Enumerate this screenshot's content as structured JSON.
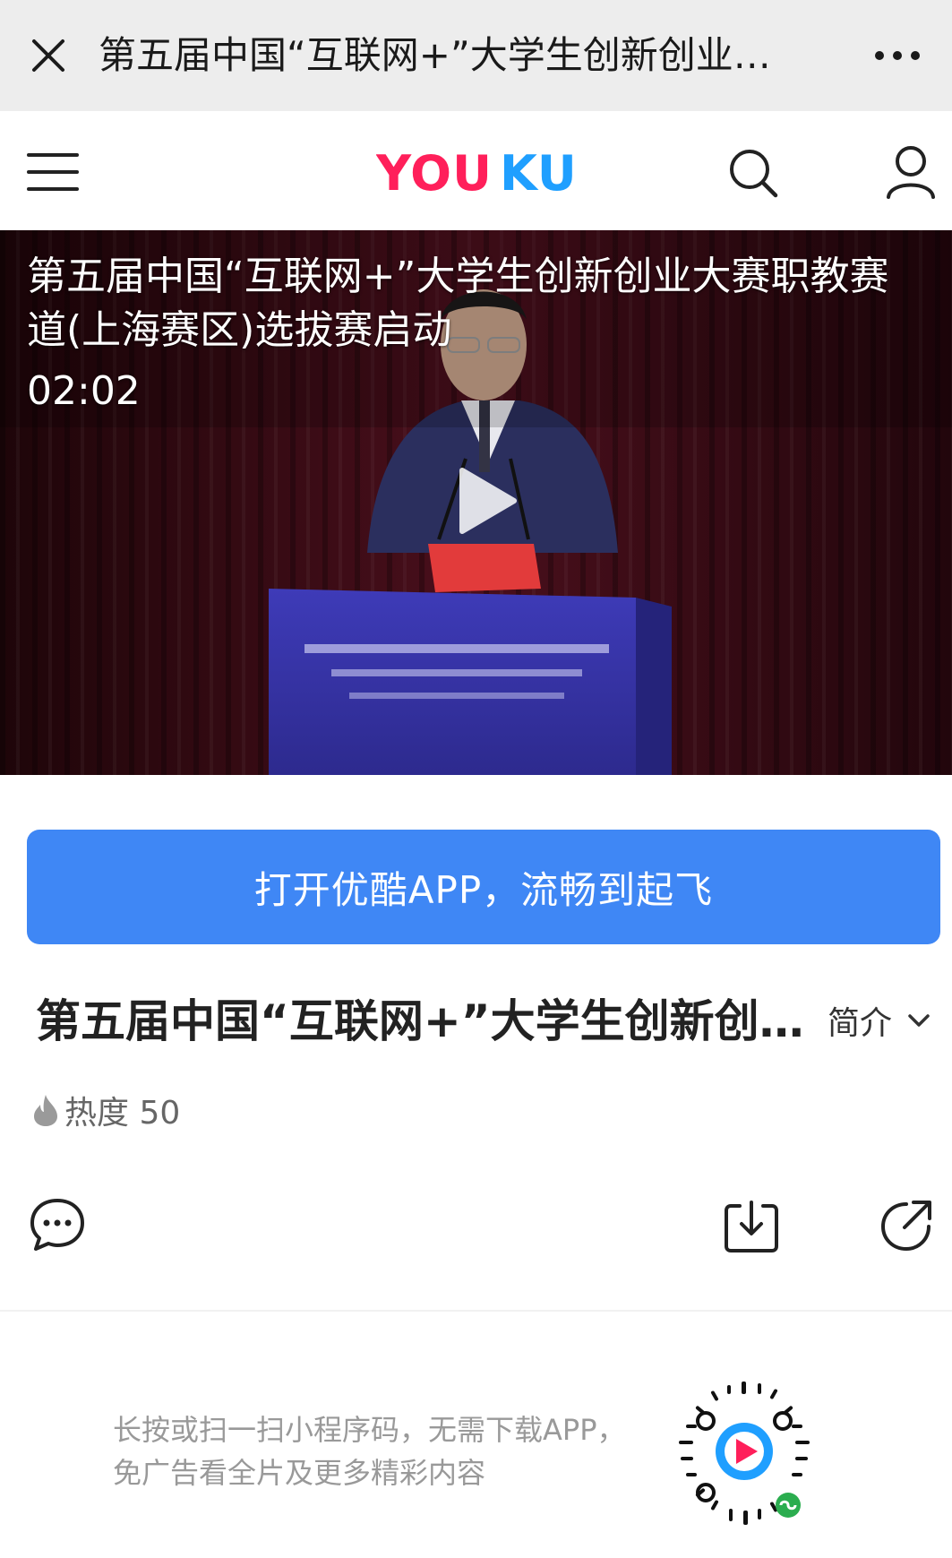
{
  "topbar": {
    "title": "第五届中国“互联网+”大学生创新创业…",
    "close_icon": "close-icon",
    "more_icon": "more-dots-icon"
  },
  "header": {
    "logo_text": "YOUKU",
    "menu_icon": "hamburger-menu-icon",
    "search_icon": "search-icon",
    "user_icon": "user-icon"
  },
  "video": {
    "title": "第五届中国“互联网+”大学生创新创业大赛职教赛道(上海赛区)选拔赛启动",
    "duration": "02:02",
    "play_icon": "play-icon"
  },
  "open_app_label": "打开优酷APP，流畅到起飞",
  "info": {
    "title": "第五届中国“互联网+”大学生创新创…",
    "intro_label": "简介",
    "heat_label": "热度 50"
  },
  "actions": {
    "comment_icon": "comment-icon",
    "download_icon": "download-icon",
    "share_icon": "share-icon"
  },
  "promo": {
    "line1": "长按或扫一扫小程序码，无需下载APP，",
    "line2": "免广告看全片及更多精彩内容"
  },
  "colors": {
    "topbar_bg": "#ededed",
    "accent_blue": "#3f87f5",
    "logo_red": "#ff1f5a",
    "logo_blue": "#1f9fff",
    "muted_text": "#999999"
  }
}
